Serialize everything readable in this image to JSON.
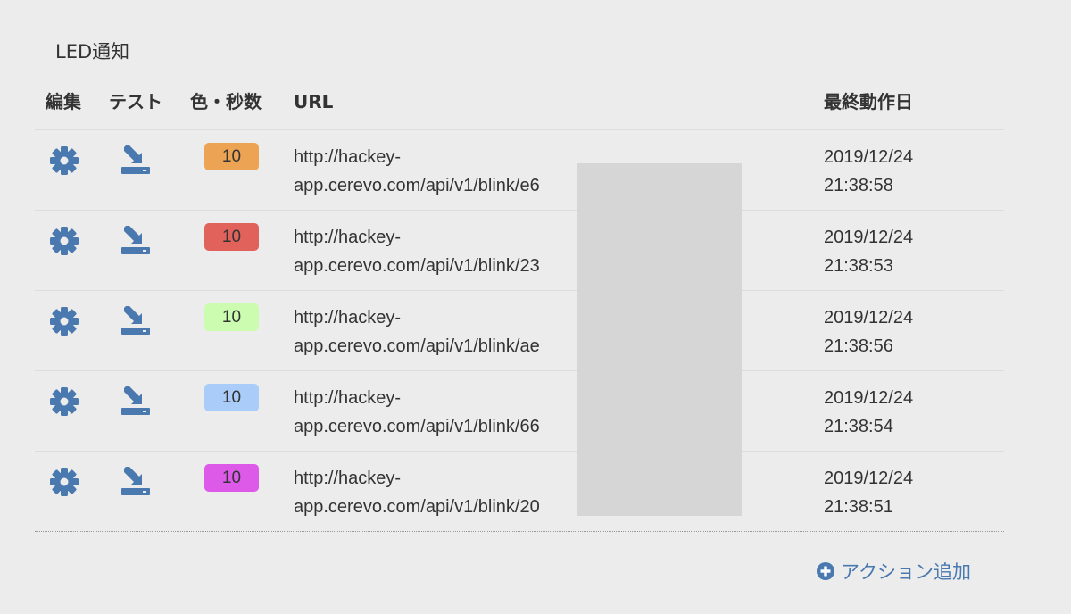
{
  "section": {
    "title": "LED通知"
  },
  "table": {
    "headers": {
      "edit": "編集",
      "test": "テスト",
      "color_seconds": "色・秒数",
      "url": "URL",
      "last_run": "最終動作日"
    },
    "rows": [
      {
        "seconds": "10",
        "color": "#eda354",
        "url_line1": "http://hackey-",
        "url_line2": "app.cerevo.com/api/v1/blink/e6",
        "date": "2019/12/24",
        "time": "21:38:58"
      },
      {
        "seconds": "10",
        "color": "#e1625b",
        "url_line1": "http://hackey-",
        "url_line2": "app.cerevo.com/api/v1/blink/23",
        "date": "2019/12/24",
        "time": "21:38:53"
      },
      {
        "seconds": "10",
        "color": "#ccfcb0",
        "url_line1": "http://hackey-",
        "url_line2": "app.cerevo.com/api/v1/blink/ae",
        "date": "2019/12/24",
        "time": "21:38:56"
      },
      {
        "seconds": "10",
        "color": "#a9cdf8",
        "url_line1": "http://hackey-",
        "url_line2": "app.cerevo.com/api/v1/blink/66",
        "date": "2019/12/24",
        "time": "21:38:54"
      },
      {
        "seconds": "10",
        "color": "#dd5ae9",
        "url_line1": "http://hackey-",
        "url_line2": "app.cerevo.com/api/v1/blink/20",
        "date": "2019/12/24",
        "time": "21:38:51"
      }
    ]
  },
  "icons": {
    "edit": "gear-icon",
    "test": "send-test-icon",
    "add": "plus-circle-icon"
  },
  "colors": {
    "accent": "#4a79b0",
    "redaction": "#d6d6d6"
  },
  "add_action": {
    "label": "アクション追加"
  }
}
